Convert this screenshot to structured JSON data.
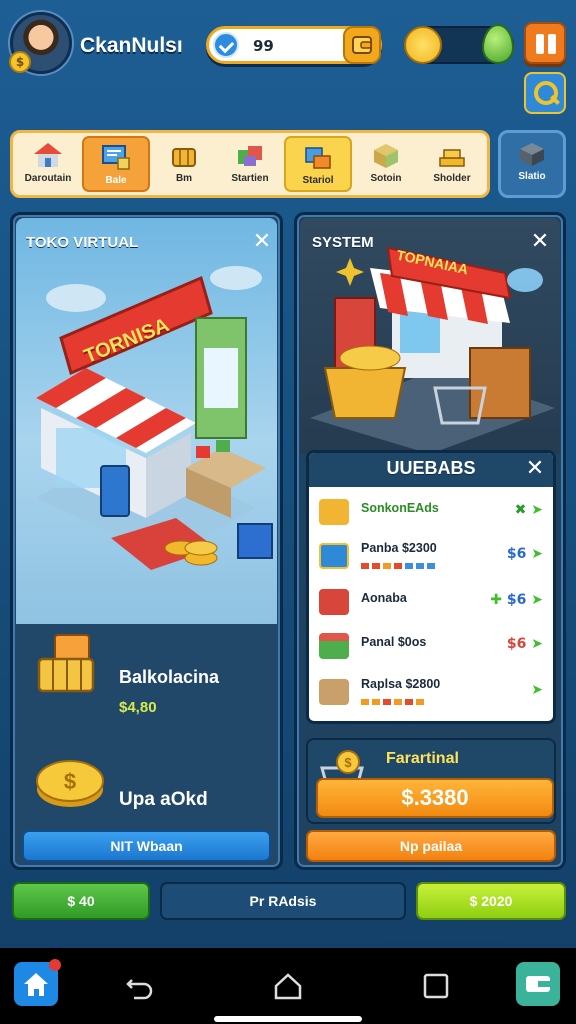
{
  "header": {
    "player_name": "CkanNulsı",
    "gem_value": "99"
  },
  "categories": [
    {
      "label": "Daroutain",
      "icon": "house-icon"
    },
    {
      "label": "Bale",
      "icon": "shop-window-icon"
    },
    {
      "label": "Bm",
      "icon": "basket-icon"
    },
    {
      "label": "Startien",
      "icon": "gift-box-icon"
    },
    {
      "label": "Stariol",
      "icon": "crates-icon"
    },
    {
      "label": "Sotoin",
      "icon": "package-icon"
    },
    {
      "label": "Sholder",
      "icon": "gold-bars-icon"
    }
  ],
  "category_extra": {
    "label": "Slatio",
    "icon": "safe-box-icon"
  },
  "left_panel": {
    "title": "TOKO VIRTUAL",
    "store_sign": "TORNISA",
    "item1_name": "Balkolacina",
    "item1_price": "$4,80",
    "item2_name": "Upa aOkd",
    "button_label": "NIT Wbaan"
  },
  "right_panel": {
    "title": "SYSTEM",
    "store_sign": "TOPNAIAA",
    "upgrades_title": "UUEBABS",
    "upgrades": [
      {
        "name": "SonkonEAds",
        "actions": [
          "✖",
          "➤"
        ]
      },
      {
        "name": "Panba $2300",
        "actions": [
          "$6",
          "➤"
        ]
      },
      {
        "name": "Aonaba",
        "actions": [
          "✚",
          "$6",
          "➤"
        ]
      },
      {
        "name": "Panal $0os",
        "actions": [
          "$6",
          "➤"
        ]
      },
      {
        "name": "Raplsa $2800",
        "actions": [
          "➤"
        ]
      }
    ],
    "featured_title": "Farartinal",
    "featured_price": "$.3380",
    "button_label": "Np pailaa"
  },
  "bottom_buttons": {
    "left": "$ 40",
    "middle": "Pr RAdsis",
    "right": "$ 2020"
  },
  "colors": {
    "background": "#17507f",
    "accent_orange": "#f28a10",
    "accent_green": "#2f9a25",
    "accent_blue": "#1c77cf"
  }
}
